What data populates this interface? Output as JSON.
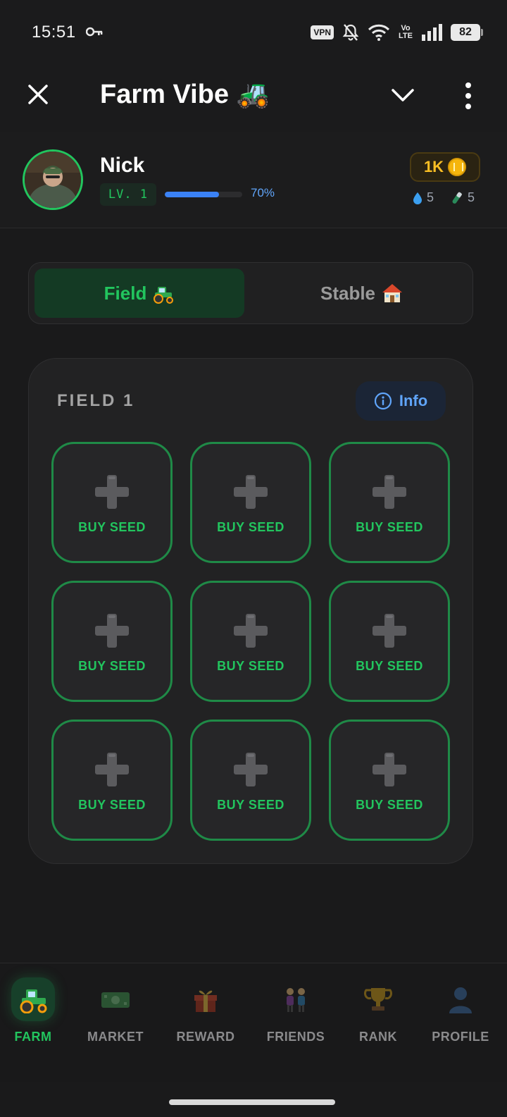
{
  "status_bar": {
    "time": "15:51",
    "vpn": "VPN",
    "volte_top": "Vo",
    "volte_bottom": "LTE",
    "battery": "82",
    "icons": [
      "key-icon",
      "bell-muted-icon",
      "wifi-icon",
      "signal-icon",
      "battery-icon"
    ]
  },
  "app_bar": {
    "title": "Farm Vibe 🚜",
    "icons": [
      "close-icon",
      "chevron-down-icon",
      "more-vertical-icon"
    ]
  },
  "profile": {
    "name": "Nick",
    "level": "LV. 1",
    "progress_percent": 70,
    "progress_label": "70%",
    "coins": "1K",
    "water": "5",
    "fertilizer": "5"
  },
  "tabs": [
    {
      "label": "Field",
      "icon": "tractor-icon",
      "active": true
    },
    {
      "label": "Stable",
      "icon": "house-icon",
      "active": false
    }
  ],
  "field": {
    "title": "FIELD 1",
    "info_label": "Info",
    "slots": [
      {
        "label": "BUY SEED"
      },
      {
        "label": "BUY SEED"
      },
      {
        "label": "BUY SEED"
      },
      {
        "label": "BUY SEED"
      },
      {
        "label": "BUY SEED"
      },
      {
        "label": "BUY SEED"
      },
      {
        "label": "BUY SEED"
      },
      {
        "label": "BUY SEED"
      },
      {
        "label": "BUY SEED"
      }
    ]
  },
  "bottom_nav": [
    {
      "label": "FARM",
      "icon": "tractor-icon",
      "active": true
    },
    {
      "label": "MARKET",
      "icon": "money-icon",
      "active": false
    },
    {
      "label": "REWARD",
      "icon": "gift-icon",
      "active": false
    },
    {
      "label": "FRIENDS",
      "icon": "friends-icon",
      "active": false
    },
    {
      "label": "RANK",
      "icon": "trophy-icon",
      "active": false
    },
    {
      "label": "PROFILE",
      "icon": "user-icon",
      "active": false
    }
  ],
  "colors": {
    "background": "#1a1a1b",
    "accent_green": "#22c55e",
    "accent_blue": "#60a5fa",
    "coin_gold": "#fbbf24"
  }
}
